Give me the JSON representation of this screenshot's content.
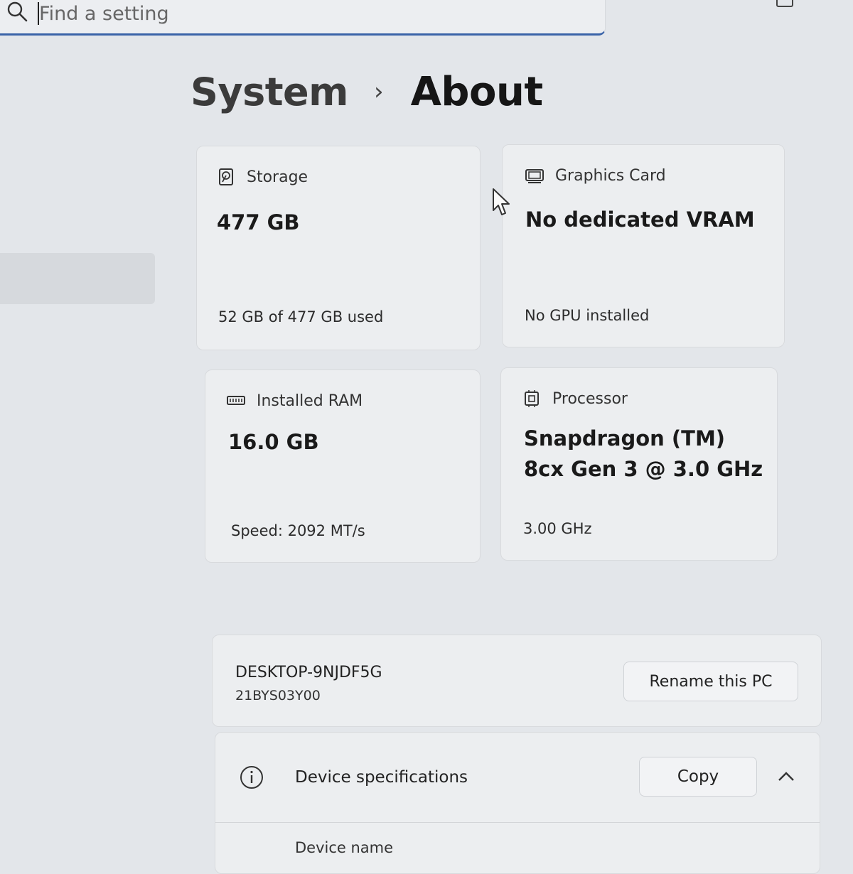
{
  "search": {
    "placeholder": "Find a setting",
    "icon": "search-icon"
  },
  "breadcrumb": {
    "parent": "System",
    "separator": "›",
    "current": "About"
  },
  "cards": {
    "storage": {
      "icon": "hard-drive-icon",
      "label": "Storage",
      "value": "477 GB",
      "detail": "52 GB of 477 GB used"
    },
    "graphics": {
      "icon": "display-icon",
      "label": "Graphics Card",
      "value": "No dedicated VRAM",
      "detail": "No GPU installed"
    },
    "ram": {
      "icon": "memory-icon",
      "label": "Installed RAM",
      "value": "16.0 GB",
      "detail": "Speed: 2092 MT/s"
    },
    "processor": {
      "icon": "processor-icon",
      "label": "Processor",
      "value": "Snapdragon (TM) 8cx Gen 3 @ 3.0 GHz",
      "detail": "3.00 GHz"
    }
  },
  "device": {
    "name": "DESKTOP-9NJDF5G",
    "model": "21BYS03Y00",
    "rename_label": "Rename this PC"
  },
  "specs": {
    "icon": "info-icon",
    "title": "Device specifications",
    "copy_label": "Copy",
    "expanded": true,
    "first_field": "Device name"
  },
  "colors": {
    "accent": "#3a63a8",
    "background": "#e3e6ea",
    "card": "#eceef0"
  }
}
